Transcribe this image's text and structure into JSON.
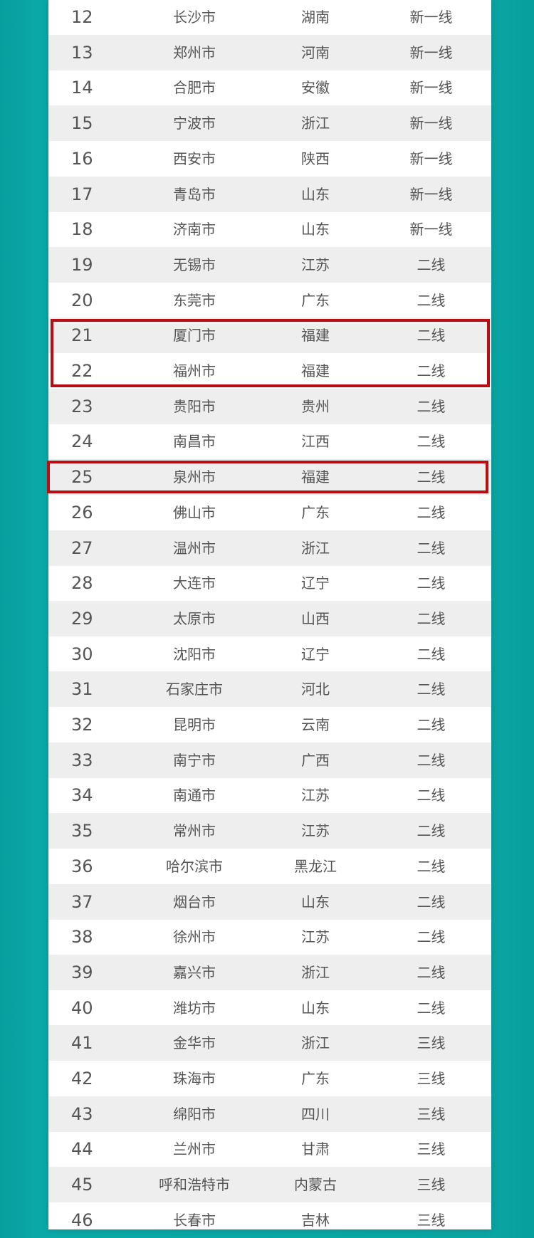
{
  "table": {
    "rows": [
      {
        "rank": "12",
        "city": "长沙市",
        "province": "湖南",
        "tier": "新一线"
      },
      {
        "rank": "13",
        "city": "郑州市",
        "province": "河南",
        "tier": "新一线"
      },
      {
        "rank": "14",
        "city": "合肥市",
        "province": "安徽",
        "tier": "新一线"
      },
      {
        "rank": "15",
        "city": "宁波市",
        "province": "浙江",
        "tier": "新一线"
      },
      {
        "rank": "16",
        "city": "西安市",
        "province": "陕西",
        "tier": "新一线"
      },
      {
        "rank": "17",
        "city": "青岛市",
        "province": "山东",
        "tier": "新一线"
      },
      {
        "rank": "18",
        "city": "济南市",
        "province": "山东",
        "tier": "新一线"
      },
      {
        "rank": "19",
        "city": "无锡市",
        "province": "江苏",
        "tier": "二线"
      },
      {
        "rank": "20",
        "city": "东莞市",
        "province": "广东",
        "tier": "二线"
      },
      {
        "rank": "21",
        "city": "厦门市",
        "province": "福建",
        "tier": "二线"
      },
      {
        "rank": "22",
        "city": "福州市",
        "province": "福建",
        "tier": "二线"
      },
      {
        "rank": "23",
        "city": "贵阳市",
        "province": "贵州",
        "tier": "二线"
      },
      {
        "rank": "24",
        "city": "南昌市",
        "province": "江西",
        "tier": "二线"
      },
      {
        "rank": "25",
        "city": "泉州市",
        "province": "福建",
        "tier": "二线"
      },
      {
        "rank": "26",
        "city": "佛山市",
        "province": "广东",
        "tier": "二线"
      },
      {
        "rank": "27",
        "city": "温州市",
        "province": "浙江",
        "tier": "二线"
      },
      {
        "rank": "28",
        "city": "大连市",
        "province": "辽宁",
        "tier": "二线"
      },
      {
        "rank": "29",
        "city": "太原市",
        "province": "山西",
        "tier": "二线"
      },
      {
        "rank": "30",
        "city": "沈阳市",
        "province": "辽宁",
        "tier": "二线"
      },
      {
        "rank": "31",
        "city": "石家庄市",
        "province": "河北",
        "tier": "二线"
      },
      {
        "rank": "32",
        "city": "昆明市",
        "province": "云南",
        "tier": "二线"
      },
      {
        "rank": "33",
        "city": "南宁市",
        "province": "广西",
        "tier": "二线"
      },
      {
        "rank": "34",
        "city": "南通市",
        "province": "江苏",
        "tier": "二线"
      },
      {
        "rank": "35",
        "city": "常州市",
        "province": "江苏",
        "tier": "二线"
      },
      {
        "rank": "36",
        "city": "哈尔滨市",
        "province": "黑龙江",
        "tier": "二线"
      },
      {
        "rank": "37",
        "city": "烟台市",
        "province": "山东",
        "tier": "二线"
      },
      {
        "rank": "38",
        "city": "徐州市",
        "province": "江苏",
        "tier": "二线"
      },
      {
        "rank": "39",
        "city": "嘉兴市",
        "province": "浙江",
        "tier": "二线"
      },
      {
        "rank": "40",
        "city": "潍坊市",
        "province": "山东",
        "tier": "二线"
      },
      {
        "rank": "41",
        "city": "金华市",
        "province": "浙江",
        "tier": "三线"
      },
      {
        "rank": "42",
        "city": "珠海市",
        "province": "广东",
        "tier": "三线"
      },
      {
        "rank": "43",
        "city": "绵阳市",
        "province": "四川",
        "tier": "三线"
      },
      {
        "rank": "44",
        "city": "兰州市",
        "province": "甘肃",
        "tier": "三线"
      },
      {
        "rank": "45",
        "city": "呼和浩特市",
        "province": "内蒙古",
        "tier": "三线"
      },
      {
        "rank": "46",
        "city": "长春市",
        "province": "吉林",
        "tier": "三线"
      }
    ],
    "highlighted_ranks": [
      [
        "21",
        "22"
      ],
      [
        "25"
      ]
    ],
    "highlight_color": "#b80d12"
  }
}
